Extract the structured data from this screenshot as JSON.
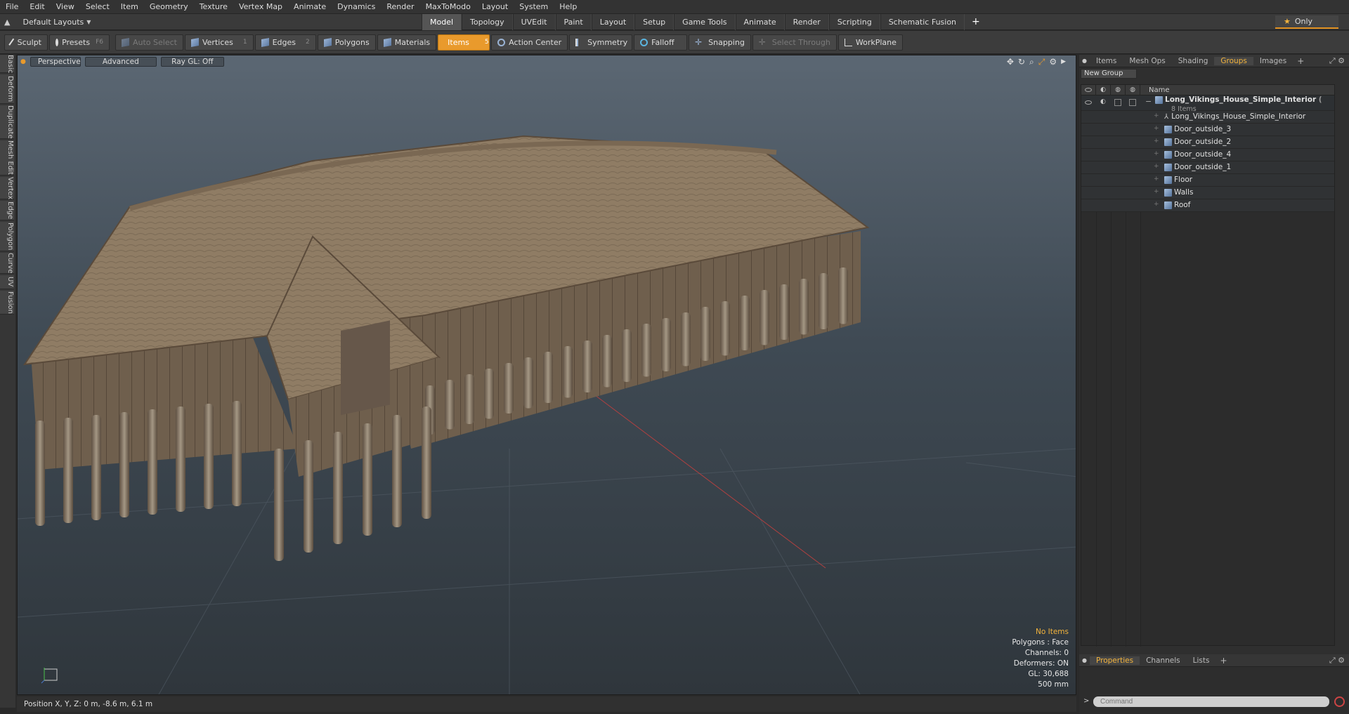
{
  "menu": [
    "File",
    "Edit",
    "View",
    "Select",
    "Item",
    "Geometry",
    "Texture",
    "Vertex Map",
    "Animate",
    "Dynamics",
    "Render",
    "MaxToModo",
    "Layout",
    "System",
    "Help"
  ],
  "layouts_label": "Default Layouts",
  "mode_tabs": [
    "Model",
    "Topology",
    "UVEdit",
    "Paint",
    "Layout",
    "Setup",
    "Game Tools",
    "Animate",
    "Render",
    "Scripting",
    "Schematic Fusion"
  ],
  "mode_tabs_active": "Model",
  "only_label": "Only",
  "toolbar": {
    "sculpt": "Sculpt",
    "presets": "Presets",
    "presets_key": "F6",
    "auto_select": "Auto Select",
    "vertices": "Vertices",
    "vertices_num": "1",
    "edges": "Edges",
    "edges_num": "2",
    "polygons": "Polygons",
    "materials": "Materials",
    "items": "Items",
    "items_num": "5",
    "action_center": "Action Center",
    "symmetry": "Symmetry",
    "falloff": "Falloff",
    "snapping": "Snapping",
    "select_through": "Select Through",
    "workplane": "WorkPlane"
  },
  "left_tabs": [
    "Basic",
    "Deform",
    "Duplicate",
    "Mesh Edit",
    "Vertex",
    "Edge",
    "Polygon",
    "Curve",
    "UV",
    "Fusion"
  ],
  "viewport": {
    "perspective": "Perspective",
    "advanced": "Advanced",
    "raygl": "Ray GL: Off",
    "info": {
      "items": "No Items",
      "polygons": "Polygons : Face",
      "channels": "Channels: 0",
      "deformers": "Deformers: ON",
      "gl": "GL: 30,688",
      "scale": "500 mm"
    }
  },
  "status": "Position X, Y, Z:  0 m, -8.6 m, 6.1 m",
  "right_tabs": [
    "Items",
    "Mesh Ops",
    "Shading",
    "Groups",
    "Images"
  ],
  "right_tabs_active": "Groups",
  "new_group": "New Group",
  "tree_header_name": "Name",
  "group": {
    "name": "Long_Vikings_House_Simple_Interior",
    "suffix": "(",
    "count": "8 Items",
    "children": [
      "Long_Vikings_House_Simple_Interior",
      "Door_outside_3",
      "Door_outside_2",
      "Door_outside_4",
      "Door_outside_1",
      "Floor",
      "Walls",
      "Roof"
    ]
  },
  "bottom_tabs": [
    "Properties",
    "Channels",
    "Lists"
  ],
  "bottom_tabs_active": "Properties",
  "command_placeholder": "Command",
  "colors": {
    "accent": "#e99a2c",
    "highlight": "#f2b33d"
  }
}
